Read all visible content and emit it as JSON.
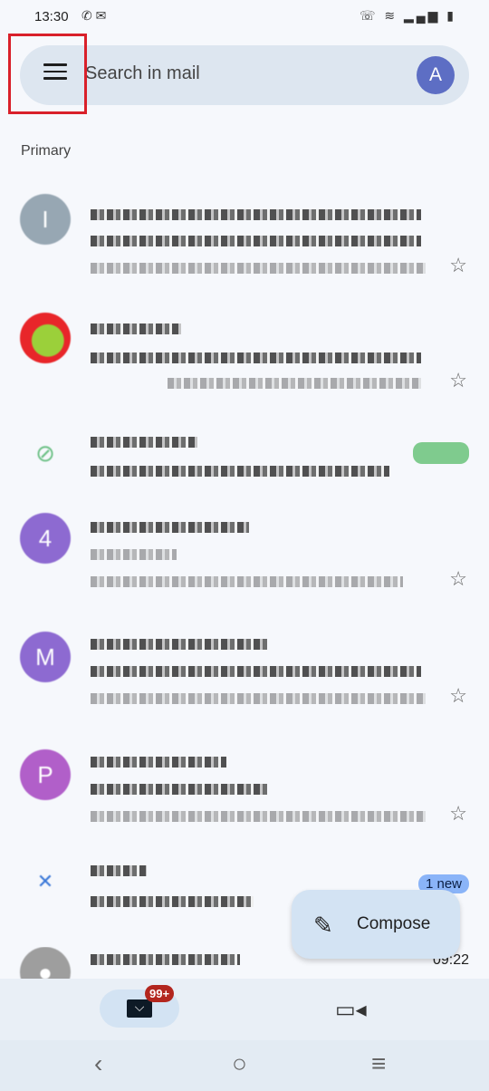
{
  "status_bar": {
    "time": "13:30",
    "left_icons": [
      "whatsapp-icon",
      "chat-icon"
    ],
    "right_icons": [
      "wifi-call-icon",
      "wifi-icon",
      "signal-icon",
      "battery-icon"
    ]
  },
  "search": {
    "placeholder": "Search in mail",
    "avatar_letter": "A",
    "avatar_color": "#5d6ec4"
  },
  "section_label": "Primary",
  "emails": [
    {
      "avatar": "I",
      "avatar_color": "#97a7b3",
      "starred": false
    },
    {
      "avatar": "",
      "avatar_color": "#e8262a",
      "starred": false
    },
    {
      "avatar": "",
      "avatar_color": "#ffffff",
      "starred": false,
      "badge_color": "#7fcb8e"
    },
    {
      "avatar": "4",
      "avatar_color": "#8d6ad1",
      "starred": false
    },
    {
      "avatar": "M",
      "avatar_color": "#8d6ad1",
      "starred": false
    },
    {
      "avatar": "P",
      "avatar_color": "#b15fc9",
      "starred": false
    },
    {
      "avatar": "",
      "avatar_color": "#ffffff",
      "badge": "1 new",
      "badge_color": "#8ab4f8"
    },
    {
      "avatar": "",
      "avatar_color": "#9e9e9e",
      "time": "09:22"
    }
  ],
  "compose": {
    "label": "Compose",
    "icon": "pencil-icon"
  },
  "bottom_nav": {
    "mail_badge": "99+",
    "badge_color": "#b3261e"
  },
  "accent_color": "#d3e3f3"
}
